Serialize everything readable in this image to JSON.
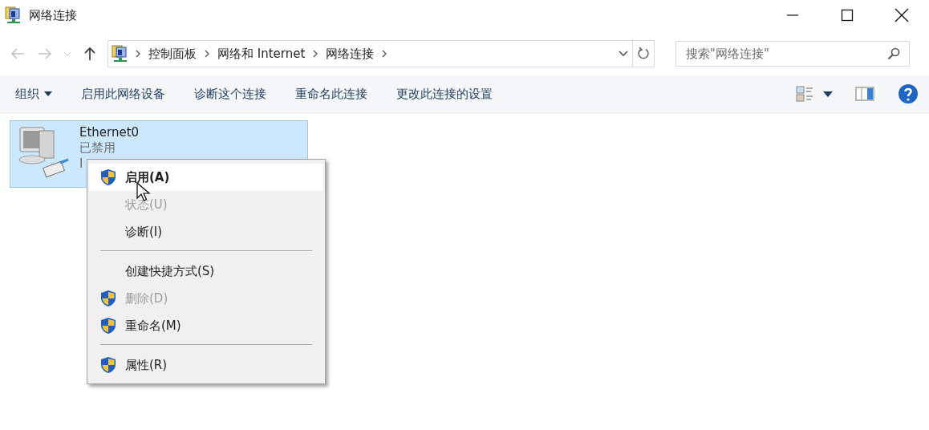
{
  "window": {
    "title": "网络连接"
  },
  "address": {
    "crumbs": [
      "控制面板",
      "网络和 Internet",
      "网络连接"
    ]
  },
  "search": {
    "placeholder": "搜索\"网络连接\""
  },
  "toolbar": {
    "commands": [
      {
        "label": "组织",
        "dropdown": true
      },
      {
        "label": "启用此网络设备",
        "dropdown": false
      },
      {
        "label": "诊断这个连接",
        "dropdown": false
      },
      {
        "label": "重命名此连接",
        "dropdown": false
      },
      {
        "label": "更改此连接的设置",
        "dropdown": false
      }
    ]
  },
  "connections": [
    {
      "name": "Ethernet0",
      "status": "已禁用",
      "device": "I",
      "selected": true
    }
  ],
  "context_menu": {
    "items": [
      {
        "kind": "item",
        "label": "启用(A)",
        "shield": true,
        "bold": true,
        "disabled": false,
        "selected": true
      },
      {
        "kind": "item",
        "label": "状态(U)",
        "shield": false,
        "bold": false,
        "disabled": true,
        "selected": false
      },
      {
        "kind": "item",
        "label": "诊断(I)",
        "shield": false,
        "bold": false,
        "disabled": false,
        "selected": false
      },
      {
        "kind": "separator"
      },
      {
        "kind": "item",
        "label": "创建快捷方式(S)",
        "shield": false,
        "bold": false,
        "disabled": false,
        "selected": false
      },
      {
        "kind": "item",
        "label": "删除(D)",
        "shield": true,
        "bold": false,
        "disabled": true,
        "selected": false
      },
      {
        "kind": "item",
        "label": "重命名(M)",
        "shield": true,
        "bold": false,
        "disabled": false,
        "selected": false
      },
      {
        "kind": "separator"
      },
      {
        "kind": "item",
        "label": "属性(R)",
        "shield": true,
        "bold": false,
        "disabled": false,
        "selected": false
      }
    ]
  }
}
